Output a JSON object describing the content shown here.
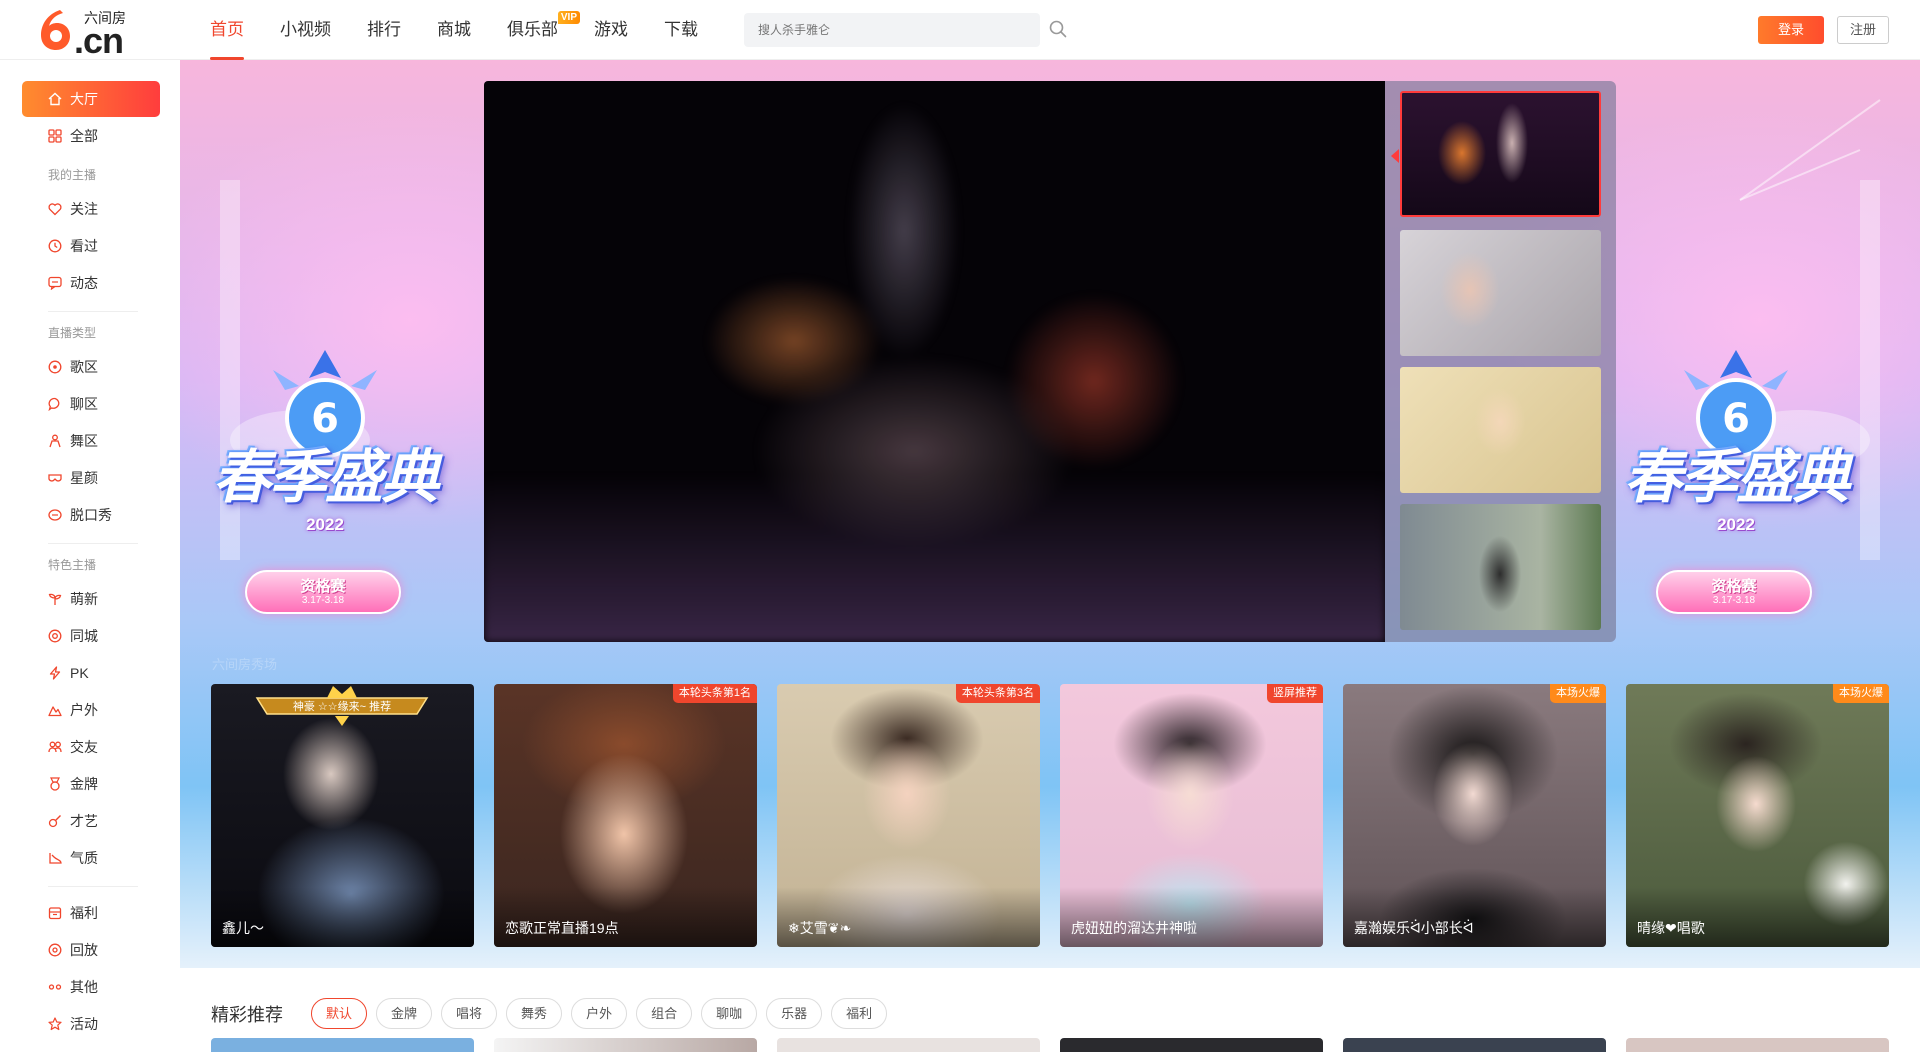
{
  "header": {
    "logo_text": "6",
    "logo_domain": ".cn",
    "logo_subtitle": "六间房",
    "nav": [
      {
        "label": "首页",
        "active": true
      },
      {
        "label": "小视频"
      },
      {
        "label": "排行"
      },
      {
        "label": "商城"
      },
      {
        "label": "俱乐部",
        "badge": "VIP"
      },
      {
        "label": "游戏"
      },
      {
        "label": "下载"
      }
    ],
    "search_placeholder": "搜人杀手雅仑",
    "login_label": "登录",
    "register_label": "注册"
  },
  "sidebar": {
    "home": {
      "label": "大厅",
      "icon": "home-icon"
    },
    "all": {
      "label": "全部",
      "icon": "grid-icon"
    },
    "section_my": "我的主播",
    "my_items": [
      {
        "label": "关注",
        "icon": "heart-icon"
      },
      {
        "label": "看过",
        "icon": "clock-icon"
      },
      {
        "label": "动态",
        "icon": "message-icon"
      }
    ],
    "section_type": "直播类型",
    "type_items": [
      {
        "label": "歌区",
        "icon": "music-icon"
      },
      {
        "label": "聊区",
        "icon": "chat-icon"
      },
      {
        "label": "舞区",
        "icon": "dance-icon"
      },
      {
        "label": "星颜",
        "icon": "mask-icon"
      },
      {
        "label": "脱口秀",
        "icon": "mic-icon"
      }
    ],
    "section_feature": "特色主播",
    "feature_items": [
      {
        "label": "萌新",
        "icon": "sprout-icon"
      },
      {
        "label": "同城",
        "icon": "location-icon"
      },
      {
        "label": "PK",
        "icon": "lightning-icon"
      },
      {
        "label": "户外",
        "icon": "mountain-icon"
      },
      {
        "label": "交友",
        "icon": "friends-icon"
      },
      {
        "label": "金牌",
        "icon": "medal-icon"
      },
      {
        "label": "才艺",
        "icon": "guitar-icon"
      },
      {
        "label": "气质",
        "icon": "heels-icon"
      }
    ],
    "other_items": [
      {
        "label": "福利",
        "icon": "gift-icon"
      },
      {
        "label": "回放",
        "icon": "replay-icon"
      },
      {
        "label": "其他",
        "icon": "more-icon"
      },
      {
        "label": "活动",
        "icon": "star-icon"
      }
    ]
  },
  "banner": {
    "promo_title": "春季盛典",
    "promo_year": "2022",
    "promo_pill": "资格赛",
    "promo_dates": "3.17-3.18",
    "watermark": "六间房秀场"
  },
  "featured_rooms": [
    {
      "name": "鑫儿～",
      "crown": "神豪 ☆☆缘来~ 推荐",
      "tag": ""
    },
    {
      "name": "恋歌正常直播19点",
      "tag": "本轮头条第1名"
    },
    {
      "name": "❄艾雪❦❧",
      "tag": "本轮头条第3名"
    },
    {
      "name": "虎妞妞的溜达井神啦",
      "tag": "竖屏推荐"
    },
    {
      "name": "嘉瀚娱乐ᐛ小部长ᐛ",
      "tag": "本场火爆"
    },
    {
      "name": "晴缘❤唱歌",
      "tag": "本场火爆"
    }
  ],
  "recommend": {
    "title": "精彩推荐",
    "chips": [
      "默认",
      "金牌",
      "唱将",
      "舞秀",
      "户外",
      "组合",
      "聊咖",
      "乐器",
      "福利"
    ]
  },
  "colors": {
    "accent": "#f0462d",
    "tag_red": "#f0462d",
    "tag_orange": "#ff8a1a"
  }
}
